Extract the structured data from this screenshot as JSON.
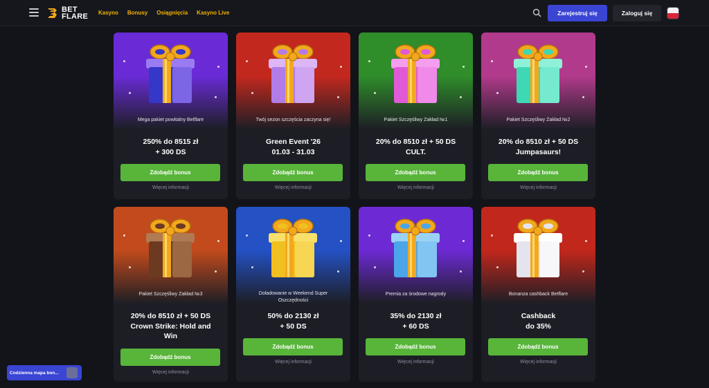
{
  "header": {
    "logo_line1": "BET",
    "logo_line2": "FLARE",
    "nav": [
      "Kasyno",
      "Bonusy",
      "Osiągnięcia",
      "Kasyno Live"
    ],
    "register_label": "Zarejestruj się",
    "login_label": "Zaloguj się"
  },
  "cards": [
    {
      "subtitle": "Mega pakiet powitalny Betflare",
      "title_l1": "250% do 8515 zł",
      "title_l2": "+ 300 DS",
      "title_l3": "",
      "button": "Zdobądź bonus",
      "more": "Więcej informacji",
      "bg": "#6a2bd6",
      "gift": "#3437c7",
      "gift2": "#9b7bf2"
    },
    {
      "subtitle": "Twój sezon szczęścia zaczyna się!",
      "title_l1": "Green Event '26",
      "title_l2": "01.03 - 31.03",
      "title_l3": "",
      "button": "Zdobądź bonus",
      "more": "Więcej informacji",
      "bg": "#c3281e",
      "gift": "#b27ce8",
      "gift2": "#dcb6f5"
    },
    {
      "subtitle": "Pakiet Szczęśliwy Zakład №1",
      "title_l1": "20% do 8510 zł + 50 DS",
      "title_l2": "CULT.",
      "title_l3": "",
      "button": "Zdobądź bonus",
      "more": "Więcej informacji",
      "bg": "#2f8d2a",
      "gift": "#e05ad8",
      "gift2": "#f59ef0"
    },
    {
      "subtitle": "Pakiet Szczęśliwy Zakład №2",
      "title_l1": "20% do 8510 zł + 50 DS",
      "title_l2": "Jumpasaurs!",
      "title_l3": "",
      "button": "Zdobądź bonus",
      "more": "Więcej informacji",
      "bg": "#b23a8c",
      "gift": "#3fd8b4",
      "gift2": "#8ff2d8"
    },
    {
      "subtitle": "Pakiet Szczęśliwy Zakład №3",
      "title_l1": "20% do 8510 zł + 50 DS",
      "title_l2": "Crown Strike: Hold and",
      "title_l3": "Win",
      "button": "Zdobądź bonus",
      "more": "Więcej informacji",
      "bg": "#c24a1c",
      "gift": "#6b3a20",
      "gift2": "#b07a52"
    },
    {
      "subtitle": "Doładowanie w Weekend Super",
      "subtitle2": "Oszczędności",
      "title_l1": "50% do 2130 zł",
      "title_l2": "+ 50 DS",
      "title_l3": "",
      "button": "Zdobądź bonus",
      "more": "Więcej informacji",
      "bg": "#2451c4",
      "gift": "#f0c020",
      "gift2": "#f8e06a"
    },
    {
      "subtitle": "Premia za środowe nagrody",
      "title_l1": "35% do 2130 zł",
      "title_l2": "+ 60 DS",
      "title_l3": "",
      "button": "Zdobądź bonus",
      "more": "Więcej informacji",
      "bg": "#6d2ad4",
      "gift": "#4aa6e8",
      "gift2": "#9ad2f6"
    },
    {
      "subtitle": "Bonanza cashback Betflare",
      "title_l1": "Cashback",
      "title_l2": "do 35%",
      "title_l3": "",
      "button": "Zdobądź bonus",
      "more": "Więcej informacji",
      "bg": "#c2271c",
      "gift": "#e4e4ee",
      "gift2": "#ffffff"
    }
  ],
  "widget": {
    "label": "Codzienna mapa bon..."
  }
}
